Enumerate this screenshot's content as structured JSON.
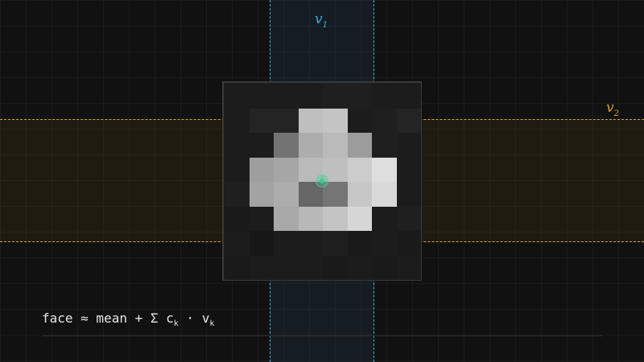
{
  "labels": {
    "v1": {
      "symbol": "v",
      "sub": "1"
    },
    "v2": {
      "symbol": "v",
      "sub": "2"
    }
  },
  "colors": {
    "v1_axis": "#4aa8d8",
    "v2_axis": "#d9a030",
    "center_marker": "#3ecb8c"
  },
  "formula": {
    "prefix": "face ≈ mean + Σ c",
    "c_sub": "k",
    "middle": " · v",
    "v_sub": "k"
  },
  "face_pixels": [
    [
      0.11,
      0.11,
      0.11,
      0.11,
      0.12,
      0.12,
      0.11,
      0.11
    ],
    [
      0.11,
      0.14,
      0.14,
      0.75,
      0.77,
      0.11,
      0.12,
      0.14
    ],
    [
      0.11,
      0.11,
      0.45,
      0.68,
      0.73,
      0.61,
      0.12,
      0.11
    ],
    [
      0.11,
      0.62,
      0.65,
      0.73,
      0.75,
      0.8,
      0.87,
      0.11
    ],
    [
      0.12,
      0.64,
      0.68,
      0.4,
      0.46,
      0.78,
      0.85,
      0.11
    ],
    [
      0.1,
      0.11,
      0.66,
      0.72,
      0.77,
      0.84,
      0.11,
      0.12
    ],
    [
      0.11,
      0.09,
      0.11,
      0.11,
      0.12,
      0.1,
      0.11,
      0.1
    ],
    [
      0.1,
      0.11,
      0.11,
      0.11,
      0.1,
      0.11,
      0.1,
      0.11
    ]
  ]
}
